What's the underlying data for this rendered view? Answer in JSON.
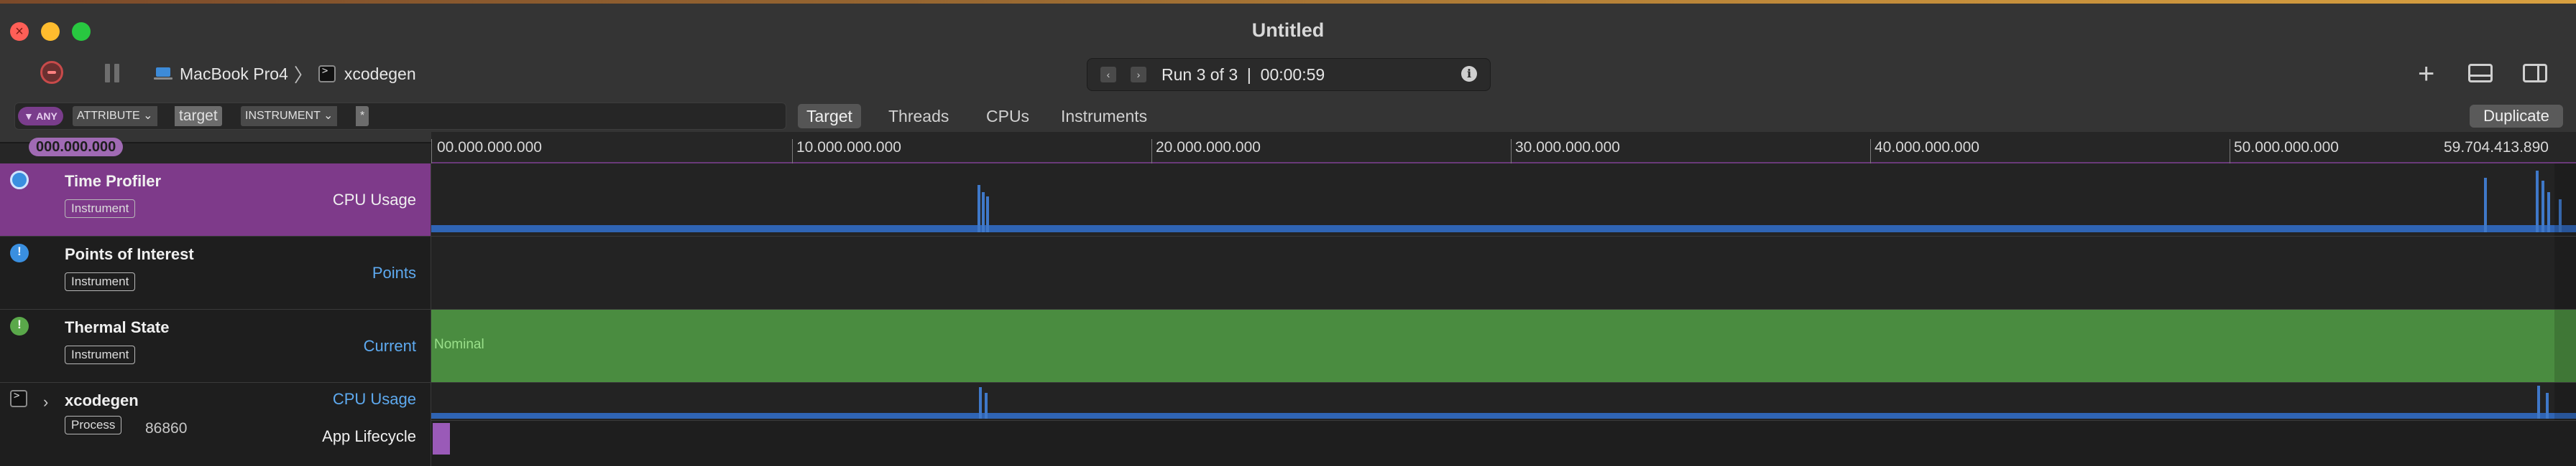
{
  "window": {
    "title": "Untitled",
    "close_glyph": "×"
  },
  "toolbar": {
    "device": "MacBook Pro4",
    "crumb_separator": "〉",
    "target_process": "xcodegen",
    "run_status": "Run 3 of 3  |  00:00:59",
    "prev_glyph": "‹",
    "next_glyph": "›",
    "info_glyph": "i",
    "add_glyph": "+"
  },
  "filter": {
    "any_label": "▼ ANY",
    "attribute_label": "ATTRIBUTE ⌄",
    "attribute_value": "target",
    "instrument_label": "INSTRUMENT ⌄",
    "instrument_value": "*"
  },
  "scope_tabs": [
    {
      "label": "Target",
      "active": true
    },
    {
      "label": "Threads",
      "active": false
    },
    {
      "label": "CPUs",
      "active": false
    },
    {
      "label": "Instruments",
      "active": false
    }
  ],
  "duplicate_label": "Duplicate",
  "timeline": {
    "cursor_time": "000.000.000",
    "ticks": [
      "00.000.000.000",
      "10.000.000.000",
      "20.000.000.000",
      "30.000.000.000",
      "40.000.000.000",
      "50.000.000.000"
    ],
    "end_time": "59.704.413.890"
  },
  "tracks": [
    {
      "name": "Time Profiler",
      "tag": "Instrument",
      "label": "CPU Usage",
      "icon": "time-profiler-icon",
      "color": "#3f78c8"
    },
    {
      "name": "Points of Interest",
      "tag": "Instrument",
      "label": "Points",
      "icon": "points-of-interest-icon"
    },
    {
      "name": "Thermal State",
      "tag": "Instrument",
      "label": "Current",
      "icon": "thermal-state-icon",
      "state": "Nominal",
      "color": "#4a8c40"
    },
    {
      "name": "xcodegen",
      "tag": "Process",
      "pid": "86860",
      "label": "CPU Usage",
      "sub_label": "App Lifecycle",
      "expand_glyph": "›",
      "icon": "terminal-icon"
    }
  ],
  "colors": {
    "selected_row": "#7e3a8a",
    "cpu_usage": "#3f78c8",
    "thermal_nominal": "#4a8c40",
    "accent_link": "#5eaaf0"
  }
}
